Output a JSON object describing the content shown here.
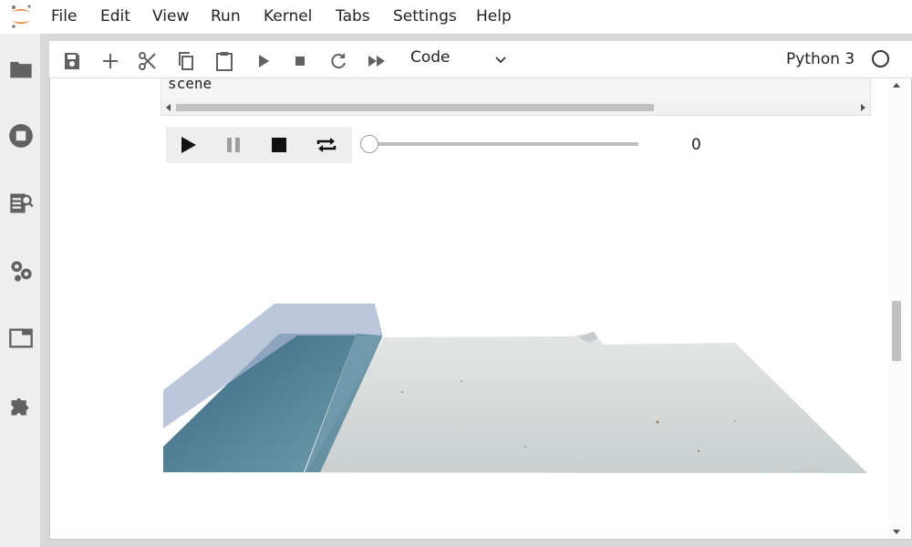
{
  "menubar": {
    "items": [
      "File",
      "Edit",
      "View",
      "Run",
      "Kernel",
      "Tabs",
      "Settings",
      "Help"
    ]
  },
  "sidebar": {
    "icons": [
      "folder-icon",
      "running-icon",
      "property-inspector-icon",
      "extension-settings-icon",
      "tabs-icon",
      "puzzle-icon"
    ]
  },
  "toolbar": {
    "cell_type": "Code",
    "kernel_name": "Python 3",
    "buttons": [
      "save-icon",
      "add-cell-icon",
      "cut-icon",
      "copy-icon",
      "paste-icon",
      "run-icon",
      "stop-icon",
      "restart-icon",
      "fast-forward-icon"
    ]
  },
  "cell": {
    "code": "scene"
  },
  "play_widget": {
    "value": "0",
    "progress": 0
  },
  "colors": {
    "accent_orange": "#f37726",
    "water": "#3f6f88",
    "water_light": "#a9b7d2",
    "terrain": "#d4d9d8"
  }
}
